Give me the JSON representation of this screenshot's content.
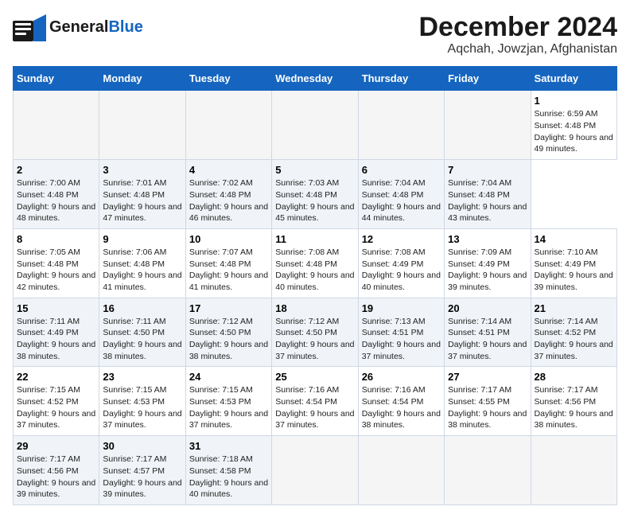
{
  "header": {
    "logo_line1": "General",
    "logo_line2": "Blue",
    "title": "December 2024",
    "subtitle": "Aqchah, Jowzjan, Afghanistan"
  },
  "calendar": {
    "days_of_week": [
      "Sunday",
      "Monday",
      "Tuesday",
      "Wednesday",
      "Thursday",
      "Friday",
      "Saturday"
    ],
    "weeks": [
      [
        null,
        null,
        null,
        null,
        null,
        null,
        {
          "day": "1",
          "sunrise": "Sunrise: 6:59 AM",
          "sunset": "Sunset: 4:48 PM",
          "daylight": "Daylight: 9 hours and 49 minutes."
        }
      ],
      [
        {
          "day": "2",
          "sunrise": "Sunrise: 7:00 AM",
          "sunset": "Sunset: 4:48 PM",
          "daylight": "Daylight: 9 hours and 48 minutes."
        },
        {
          "day": "3",
          "sunrise": "Sunrise: 7:01 AM",
          "sunset": "Sunset: 4:48 PM",
          "daylight": "Daylight: 9 hours and 47 minutes."
        },
        {
          "day": "4",
          "sunrise": "Sunrise: 7:02 AM",
          "sunset": "Sunset: 4:48 PM",
          "daylight": "Daylight: 9 hours and 46 minutes."
        },
        {
          "day": "5",
          "sunrise": "Sunrise: 7:03 AM",
          "sunset": "Sunset: 4:48 PM",
          "daylight": "Daylight: 9 hours and 45 minutes."
        },
        {
          "day": "6",
          "sunrise": "Sunrise: 7:04 AM",
          "sunset": "Sunset: 4:48 PM",
          "daylight": "Daylight: 9 hours and 44 minutes."
        },
        {
          "day": "7",
          "sunrise": "Sunrise: 7:04 AM",
          "sunset": "Sunset: 4:48 PM",
          "daylight": "Daylight: 9 hours and 43 minutes."
        }
      ],
      [
        {
          "day": "8",
          "sunrise": "Sunrise: 7:05 AM",
          "sunset": "Sunset: 4:48 PM",
          "daylight": "Daylight: 9 hours and 42 minutes."
        },
        {
          "day": "9",
          "sunrise": "Sunrise: 7:06 AM",
          "sunset": "Sunset: 4:48 PM",
          "daylight": "Daylight: 9 hours and 41 minutes."
        },
        {
          "day": "10",
          "sunrise": "Sunrise: 7:07 AM",
          "sunset": "Sunset: 4:48 PM",
          "daylight": "Daylight: 9 hours and 41 minutes."
        },
        {
          "day": "11",
          "sunrise": "Sunrise: 7:08 AM",
          "sunset": "Sunset: 4:48 PM",
          "daylight": "Daylight: 9 hours and 40 minutes."
        },
        {
          "day": "12",
          "sunrise": "Sunrise: 7:08 AM",
          "sunset": "Sunset: 4:49 PM",
          "daylight": "Daylight: 9 hours and 40 minutes."
        },
        {
          "day": "13",
          "sunrise": "Sunrise: 7:09 AM",
          "sunset": "Sunset: 4:49 PM",
          "daylight": "Daylight: 9 hours and 39 minutes."
        },
        {
          "day": "14",
          "sunrise": "Sunrise: 7:10 AM",
          "sunset": "Sunset: 4:49 PM",
          "daylight": "Daylight: 9 hours and 39 minutes."
        }
      ],
      [
        {
          "day": "15",
          "sunrise": "Sunrise: 7:11 AM",
          "sunset": "Sunset: 4:49 PM",
          "daylight": "Daylight: 9 hours and 38 minutes."
        },
        {
          "day": "16",
          "sunrise": "Sunrise: 7:11 AM",
          "sunset": "Sunset: 4:50 PM",
          "daylight": "Daylight: 9 hours and 38 minutes."
        },
        {
          "day": "17",
          "sunrise": "Sunrise: 7:12 AM",
          "sunset": "Sunset: 4:50 PM",
          "daylight": "Daylight: 9 hours and 38 minutes."
        },
        {
          "day": "18",
          "sunrise": "Sunrise: 7:12 AM",
          "sunset": "Sunset: 4:50 PM",
          "daylight": "Daylight: 9 hours and 37 minutes."
        },
        {
          "day": "19",
          "sunrise": "Sunrise: 7:13 AM",
          "sunset": "Sunset: 4:51 PM",
          "daylight": "Daylight: 9 hours and 37 minutes."
        },
        {
          "day": "20",
          "sunrise": "Sunrise: 7:14 AM",
          "sunset": "Sunset: 4:51 PM",
          "daylight": "Daylight: 9 hours and 37 minutes."
        },
        {
          "day": "21",
          "sunrise": "Sunrise: 7:14 AM",
          "sunset": "Sunset: 4:52 PM",
          "daylight": "Daylight: 9 hours and 37 minutes."
        }
      ],
      [
        {
          "day": "22",
          "sunrise": "Sunrise: 7:15 AM",
          "sunset": "Sunset: 4:52 PM",
          "daylight": "Daylight: 9 hours and 37 minutes."
        },
        {
          "day": "23",
          "sunrise": "Sunrise: 7:15 AM",
          "sunset": "Sunset: 4:53 PM",
          "daylight": "Daylight: 9 hours and 37 minutes."
        },
        {
          "day": "24",
          "sunrise": "Sunrise: 7:15 AM",
          "sunset": "Sunset: 4:53 PM",
          "daylight": "Daylight: 9 hours and 37 minutes."
        },
        {
          "day": "25",
          "sunrise": "Sunrise: 7:16 AM",
          "sunset": "Sunset: 4:54 PM",
          "daylight": "Daylight: 9 hours and 37 minutes."
        },
        {
          "day": "26",
          "sunrise": "Sunrise: 7:16 AM",
          "sunset": "Sunset: 4:54 PM",
          "daylight": "Daylight: 9 hours and 38 minutes."
        },
        {
          "day": "27",
          "sunrise": "Sunrise: 7:17 AM",
          "sunset": "Sunset: 4:55 PM",
          "daylight": "Daylight: 9 hours and 38 minutes."
        },
        {
          "day": "28",
          "sunrise": "Sunrise: 7:17 AM",
          "sunset": "Sunset: 4:56 PM",
          "daylight": "Daylight: 9 hours and 38 minutes."
        }
      ],
      [
        {
          "day": "29",
          "sunrise": "Sunrise: 7:17 AM",
          "sunset": "Sunset: 4:56 PM",
          "daylight": "Daylight: 9 hours and 39 minutes."
        },
        {
          "day": "30",
          "sunrise": "Sunrise: 7:17 AM",
          "sunset": "Sunset: 4:57 PM",
          "daylight": "Daylight: 9 hours and 39 minutes."
        },
        {
          "day": "31",
          "sunrise": "Sunrise: 7:18 AM",
          "sunset": "Sunset: 4:58 PM",
          "daylight": "Daylight: 9 hours and 40 minutes."
        },
        null,
        null,
        null,
        null
      ]
    ]
  }
}
